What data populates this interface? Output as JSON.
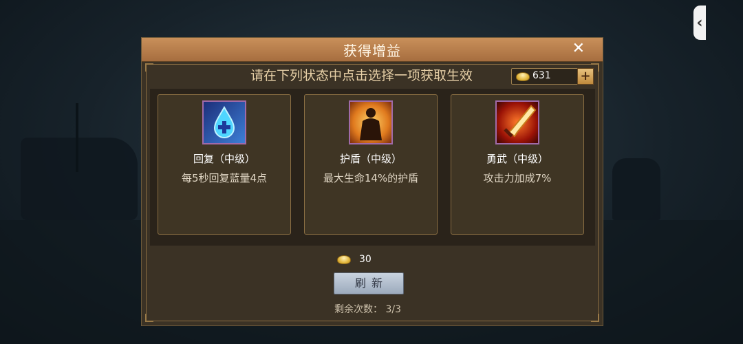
{
  "dialog": {
    "title": "获得增益",
    "close_label": "✕",
    "instruction": "请在下列状态中点击选择一项获取生效",
    "currency": {
      "amount": "631",
      "plus_label": "+"
    },
    "cards": [
      {
        "icon": "blue-droplet-plus-icon",
        "name": "回复（中级）",
        "desc": "每5秒回复蓝量4点"
      },
      {
        "icon": "shield-warrior-icon",
        "name": "护盾（中级）",
        "desc": "最大生命14%的护盾"
      },
      {
        "icon": "flaming-sword-icon",
        "name": "勇武（中级）",
        "desc": "攻击力加成7%"
      }
    ],
    "refresh": {
      "cost": "30",
      "label": "刷新"
    },
    "remaining": "剩余次数： 3/3"
  },
  "colors": {
    "title_bar": "#b8804b",
    "panel": "#3b3225",
    "card_border": "#8b6f43",
    "icon_frame": "#a06aa8"
  }
}
